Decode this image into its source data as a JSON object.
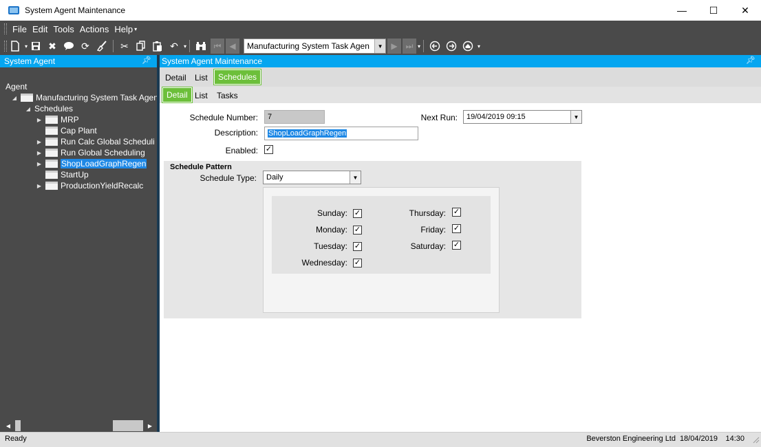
{
  "window": {
    "title": "System Agent Maintenance",
    "minimize": "—",
    "maximize": "☐",
    "close": "✕"
  },
  "menu": {
    "items": [
      "File",
      "Edit",
      "Tools",
      "Actions",
      "Help"
    ]
  },
  "toolbar": {
    "navigator_value": "Manufacturing System Task Agen"
  },
  "left_panel": {
    "title": "System Agent",
    "tree": [
      {
        "label": "Agent",
        "level": 0,
        "expander": "",
        "folder": false
      },
      {
        "label": "Manufacturing System Task Agent",
        "level": 1,
        "expander": "◢",
        "folder": true
      },
      {
        "label": "Schedules",
        "level": 2,
        "expander": "◢",
        "folder": false
      },
      {
        "label": "MRP",
        "level": 3,
        "expander": "▶",
        "folder": true
      },
      {
        "label": "Cap Plant",
        "level": 3,
        "expander": "",
        "folder": true
      },
      {
        "label": "Run Calc Global Scheduli",
        "level": 3,
        "expander": "▶",
        "folder": true
      },
      {
        "label": "Run Global Scheduling",
        "level": 3,
        "expander": "▶",
        "folder": true
      },
      {
        "label": "ShopLoadGraphRegen",
        "level": 3,
        "expander": "▶",
        "folder": true,
        "selected": true
      },
      {
        "label": "StartUp",
        "level": 3,
        "expander": "",
        "folder": true
      },
      {
        "label": "ProductionYieldRecalc",
        "level": 3,
        "expander": "▶",
        "folder": true
      }
    ]
  },
  "right_panel": {
    "title": "System Agent Maintenance",
    "tabs": [
      "Detail",
      "List",
      "Schedules"
    ],
    "active_tab": "Schedules",
    "subtabs": [
      "Detail",
      "List",
      "Tasks"
    ],
    "active_subtab": "Detail"
  },
  "form": {
    "schedule_number_label": "Schedule Number:",
    "schedule_number": "7",
    "next_run_label": "Next Run:",
    "next_run": "19/04/2019 09:15",
    "description_label": "Description:",
    "description": "ShopLoadGraphRegen",
    "enabled_label": "Enabled:",
    "enabled": true,
    "pattern_title": "Schedule Pattern",
    "schedule_type_label": "Schedule Type:",
    "schedule_type": "Daily",
    "days_left": [
      {
        "label": "Sunday:",
        "checked": true
      },
      {
        "label": "Monday:",
        "checked": true
      },
      {
        "label": "Tuesday:",
        "checked": true
      },
      {
        "label": "Wednesday:",
        "checked": true
      }
    ],
    "days_right": [
      {
        "label": "Thursday:",
        "checked": true
      },
      {
        "label": "Friday:",
        "checked": true
      },
      {
        "label": "Saturday:",
        "checked": true
      }
    ]
  },
  "status": {
    "ready": "Ready",
    "company": "Beverston Engineering Ltd",
    "date": "18/04/2019",
    "time": "14:30"
  },
  "colors": {
    "accent_blue": "#05a6f0",
    "active_tab_green": "#6cbf3a",
    "dark_panel": "#4a4a4a"
  }
}
